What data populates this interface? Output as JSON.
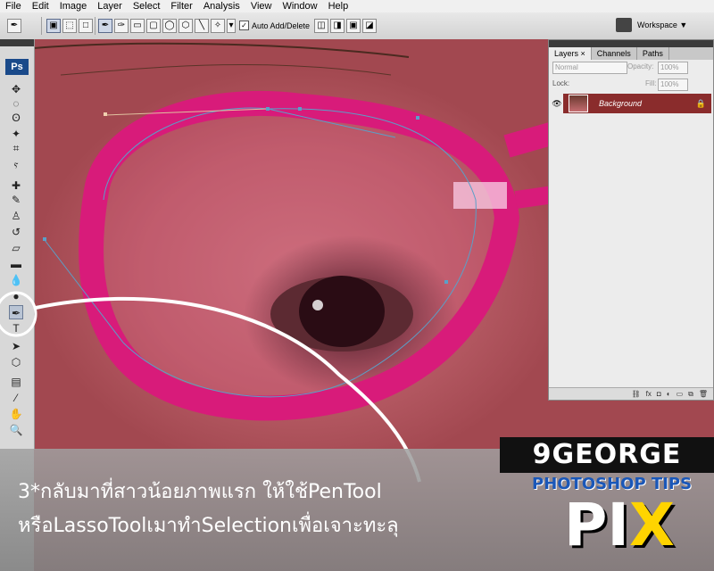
{
  "menu": [
    "File",
    "Edit",
    "Image",
    "Layer",
    "Select",
    "Filter",
    "Analysis",
    "View",
    "Window",
    "Help"
  ],
  "options": {
    "auto_add_delete_label": "Auto Add/Delete",
    "auto_add_delete_checked": true,
    "workspace_label": "Workspace ▼"
  },
  "toolbox": {
    "logo_text": "Ps",
    "tools": [
      {
        "name": "move-tool",
        "glyph": "✥"
      },
      {
        "name": "marquee-tool",
        "glyph": "◌"
      },
      {
        "name": "lasso-tool",
        "glyph": "ʘ"
      },
      {
        "name": "magic-wand-tool",
        "glyph": "✦"
      },
      {
        "name": "crop-tool",
        "glyph": "⌗"
      },
      {
        "name": "eyedropper-tool",
        "glyph": "ⲋ"
      },
      {
        "name": "healing-tool",
        "glyph": "✚"
      },
      {
        "name": "brush-tool",
        "glyph": "✎"
      },
      {
        "name": "stamp-tool",
        "glyph": "♙"
      },
      {
        "name": "history-brush-tool",
        "glyph": "↺"
      },
      {
        "name": "eraser-tool",
        "glyph": "▱"
      },
      {
        "name": "gradient-tool",
        "glyph": "▬"
      },
      {
        "name": "blur-tool",
        "glyph": "💧"
      },
      {
        "name": "dodge-tool",
        "glyph": "●"
      },
      {
        "name": "pen-tool",
        "glyph": "✒"
      },
      {
        "name": "type-tool",
        "glyph": "T"
      },
      {
        "name": "path-selection-tool",
        "glyph": "➤"
      },
      {
        "name": "shape-tool",
        "glyph": "⬡"
      },
      {
        "name": "notes-tool",
        "glyph": "▤"
      },
      {
        "name": "eyedropper2-tool",
        "glyph": "⁄"
      },
      {
        "name": "hand-tool",
        "glyph": "✋"
      },
      {
        "name": "zoom-tool",
        "glyph": "🔍"
      }
    ],
    "active_tool": "pen-tool"
  },
  "layers_panel": {
    "tabs": [
      "Layers ×",
      "Channels",
      "Paths"
    ],
    "blend_mode": "Normal",
    "opacity_label": "Opacity:",
    "opacity_value": "100%",
    "lock_label": "Lock:",
    "fill_label": "Fill:",
    "fill_value": "100%",
    "layer_name": "Background",
    "footer_icons": [
      "link-icon",
      "fx-icon",
      "mask-icon",
      "adjustment-icon",
      "group-icon",
      "new-layer-icon",
      "trash-icon"
    ]
  },
  "caption": {
    "line1": "3*กลับมาที่สาวน้อยภาพแรก ให้ใช้PenTool",
    "line2": "หรือLassoToolเมาทำSelectionเพื่อเจาะทะลุ"
  },
  "logo": {
    "brand": "9GEORGE",
    "tagline": "PHOTOSHOP TIPS",
    "pix": "PI",
    "pix_x": "X"
  },
  "colors": {
    "glasses_frame": "#d81b7a",
    "layer_selected": "#8a2c2c",
    "path_line": "#5aa0c8",
    "logo_yellow": "#ffd400"
  }
}
